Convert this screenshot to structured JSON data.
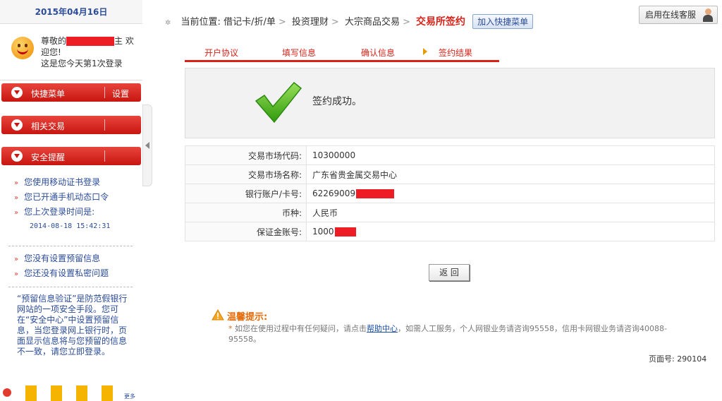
{
  "sidebar": {
    "date": "2015年04月16日",
    "welcome_prefix": "尊敬的",
    "welcome_suffix": "主 欢迎您!",
    "login_count": "这是您今天第1次登录",
    "quick_menu": "快捷菜单",
    "settings": "设置",
    "related": "相关交易",
    "security": "安全提醒",
    "security_items": [
      "您使用移动证书登录",
      "您已开通手机动态口令",
      "您上次登录时间是:"
    ],
    "last_login_time": "2014-08-18 15:42:31",
    "security_items2": [
      "您没有设置预留信息",
      "您还没有设置私密问题"
    ],
    "notice": "“预留信息验证”是防范假银行网站的一项安全手段。您可在“安全中心”中设置预留信息，当您登录网上银行时，页面显示信息将与您预留的信息不一致，请您立即登录。",
    "more": "更多"
  },
  "header": {
    "location_label": "当前位置:",
    "crumbs": [
      "借记卡/折/单",
      "投资理财",
      "大宗商品交易"
    ],
    "current": "交易所签约",
    "quick_add": "加入快捷菜单",
    "online_service": "启用在线客服"
  },
  "steps": [
    "开户协议",
    "填写信息",
    "确认信息",
    "签约结果"
  ],
  "result": {
    "message": "签约成功。"
  },
  "info": [
    {
      "key": "交易市场代码:",
      "value": "10300000"
    },
    {
      "key": "交易市场名称:",
      "value": "广东省贵金属交易中心"
    },
    {
      "key": "银行账户/卡号:",
      "value": "62269009"
    },
    {
      "key": "币种:",
      "value": "人民币"
    },
    {
      "key": "保证金账号:",
      "value": "1000"
    }
  ],
  "return_button": "返 回",
  "tips": {
    "title": "温馨提示:",
    "star": "*",
    "text_before": "如您在使用过程中有任何疑问，请点击",
    "help_link": "帮助中心",
    "text_after": "，如需人工服务，个人网银业务请咨询95558，信用卡网银业务请咨询40088-95558。"
  },
  "page_number": "页面号: 290104",
  "colors": {
    "accent_red": "#d7241a",
    "link_blue": "#2b4c9a",
    "warning_orange": "#e36c09"
  }
}
